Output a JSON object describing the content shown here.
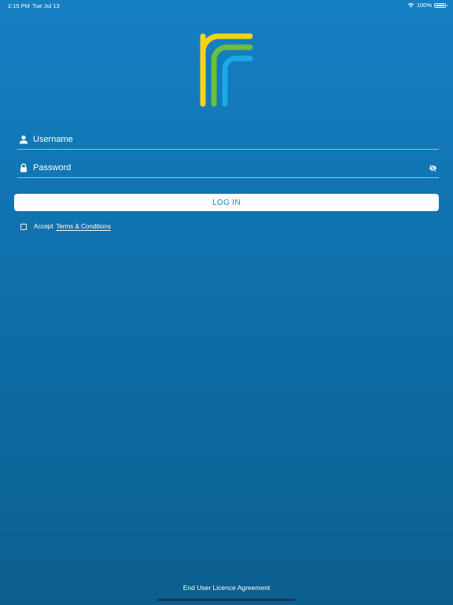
{
  "status_bar": {
    "time": "2:15 PM",
    "date": "Tue Jul 13",
    "battery": "100%",
    "icons": [
      "wifi-icon",
      "battery-icon"
    ]
  },
  "logo": {
    "icon": "brand-logo",
    "colors": [
      "#f2d31a",
      "#6cbf3a",
      "#1aa9e6"
    ]
  },
  "login_form": {
    "username": {
      "placeholder": "Username",
      "value": "",
      "icon": "user-icon"
    },
    "password": {
      "placeholder": "Password",
      "value": "",
      "icon": "lock-icon",
      "toggle_icon": "eye-off-icon"
    },
    "login_label": "LOG IN",
    "accept_label": "Accept",
    "terms_label": "Terms & Conditions",
    "accepted": false
  },
  "footer": {
    "eula_label": "End User Licence Agreement"
  },
  "colors": {
    "background_top": "#1680c4",
    "background_bottom": "#0b5f8f",
    "button_text": "#1a86c8"
  }
}
